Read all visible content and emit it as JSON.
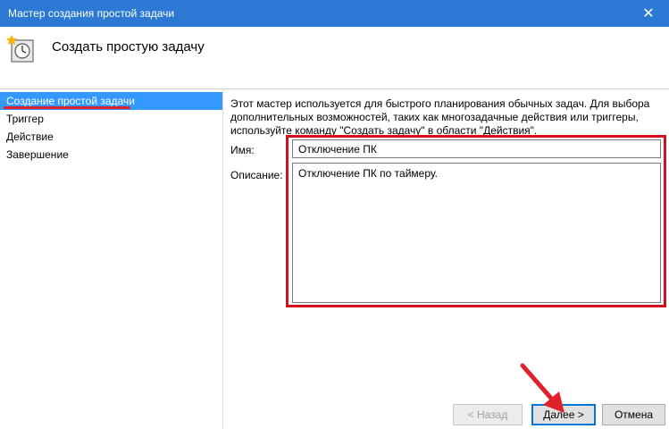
{
  "window": {
    "title": "Мастер создания простой задачи",
    "close_glyph": "✕"
  },
  "header": {
    "title": "Создать простую задачу",
    "icon": "task-scheduler-icon"
  },
  "sidebar": {
    "items": [
      {
        "label": "Создание простой задачи",
        "active": true
      },
      {
        "label": "Триггер",
        "active": false
      },
      {
        "label": "Действие",
        "active": false
      },
      {
        "label": "Завершение",
        "active": false
      }
    ]
  },
  "main": {
    "description": "Этот мастер используется для быстрого планирования обычных задач.  Для выбора дополнительных возможностей, таких как многозадачные действия или триггеры, используйте команду \"Создать задачу\" в области \"Действия\".",
    "name_label": "Имя:",
    "name_value": "Отключение ПК",
    "desc_label": "Описание:",
    "desc_value": "Отключение ПК по таймеру."
  },
  "buttons": {
    "back": "< Назад",
    "next": "Далее >",
    "cancel": "Отмена"
  },
  "colors": {
    "titlebar": "#2b79d3",
    "selection": "#3399ff",
    "highlight_red": "#d4101e"
  }
}
